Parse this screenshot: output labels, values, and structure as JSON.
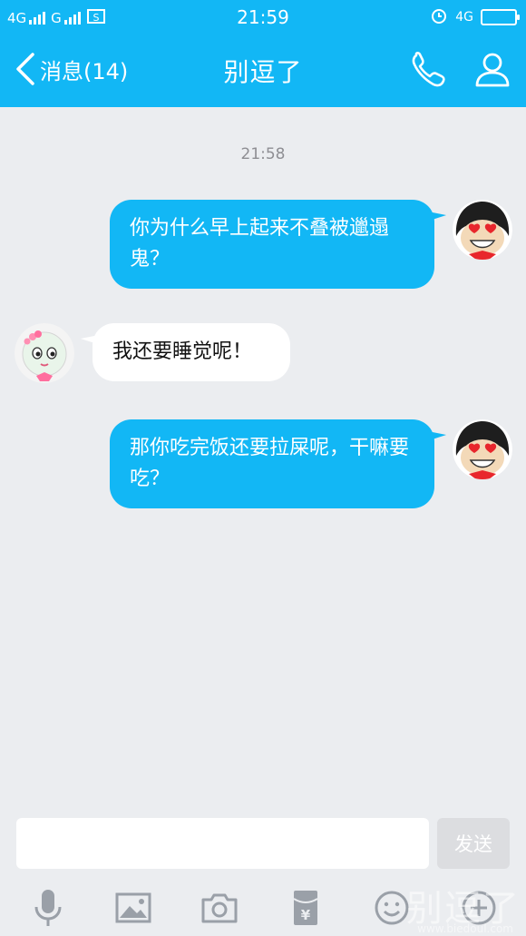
{
  "status_bar": {
    "network1": "4G",
    "network2": "G",
    "time": "21:59",
    "network3": "4G"
  },
  "header": {
    "back_label": "消息(14)",
    "title": "别逗了"
  },
  "chat": {
    "timestamp": "21:58",
    "messages": [
      {
        "side": "out",
        "text": "你为什么早上起来不叠被邋遢鬼？"
      },
      {
        "side": "in",
        "text": "我还要睡觉呢！"
      },
      {
        "side": "out",
        "text": "那你吃完饭还要拉屎呢，干嘛要吃？"
      }
    ]
  },
  "composer": {
    "input_value": "",
    "send_label": "发送"
  },
  "toolbar": {
    "icons": [
      "microphone-icon",
      "image-icon",
      "camera-icon",
      "red-packet-icon",
      "emoji-icon",
      "plus-icon"
    ]
  },
  "watermark": {
    "text": "别逗了",
    "url": "www.biedoul.com"
  },
  "colors": {
    "accent": "#12b7f5",
    "background": "#ebedf0",
    "incoming_bubble": "#ffffff"
  }
}
